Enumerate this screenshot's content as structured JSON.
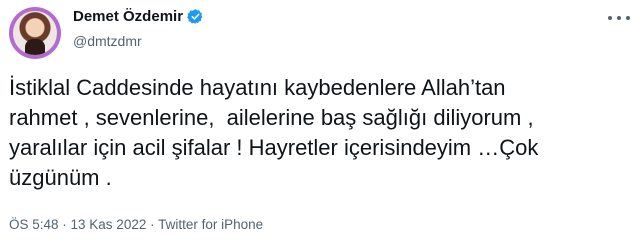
{
  "user": {
    "display_name": "Demet Özdemir",
    "handle": "@dmtzdmr"
  },
  "tweet": {
    "lines": [
      "İstiklal Caddesinde hayatını kaybedenlere Allah’tan",
      "rahmet , sevenlerine,  ailelerine baş sağlığı diliyorum ,",
      "yaralılar için acil şifalar ! Hayretler içerisindeyim …Çok",
      "üzgünüm ."
    ]
  },
  "meta": {
    "time": "ÖS 5:48",
    "separator1": " · ",
    "date": "13 Kas 2022",
    "separator2": " · ",
    "client": "Twitter for iPhone"
  },
  "icons": {
    "verified": "verified-badge-icon",
    "more": "more-options-icon"
  },
  "colors": {
    "verified": "#1d9bf0",
    "avatar_ring": "#b46bd0",
    "secondary_text": "#536471"
  }
}
